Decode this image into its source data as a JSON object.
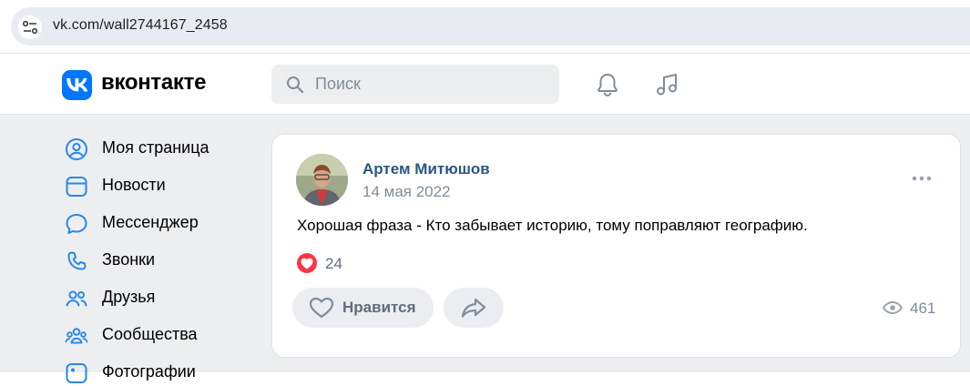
{
  "browser": {
    "url": "vk.com/wall2744167_2458"
  },
  "header": {
    "logo_text": "вконтакте",
    "search_placeholder": "Поиск"
  },
  "sidebar": {
    "items": [
      {
        "label": "Моя страница",
        "icon": "user-circle-icon"
      },
      {
        "label": "Новости",
        "icon": "news-icon"
      },
      {
        "label": "Мессенджер",
        "icon": "message-icon"
      },
      {
        "label": "Звонки",
        "icon": "phone-icon"
      },
      {
        "label": "Друзья",
        "icon": "friends-icon"
      },
      {
        "label": "Сообщества",
        "icon": "communities-icon"
      },
      {
        "label": "Фотографии",
        "icon": "photos-icon"
      }
    ]
  },
  "post": {
    "author": "Артем Митюшов",
    "date": "14 мая 2022",
    "text": "Хорошая фраза - Кто забывает историю, тому поправляют географию.",
    "reactions_count": "24",
    "like_label": "Нравится",
    "views_count": "461"
  },
  "colors": {
    "accent": "#0077ff",
    "author_link": "#2a5885",
    "reaction_red": "#ff3347",
    "background": "#edeef0"
  }
}
